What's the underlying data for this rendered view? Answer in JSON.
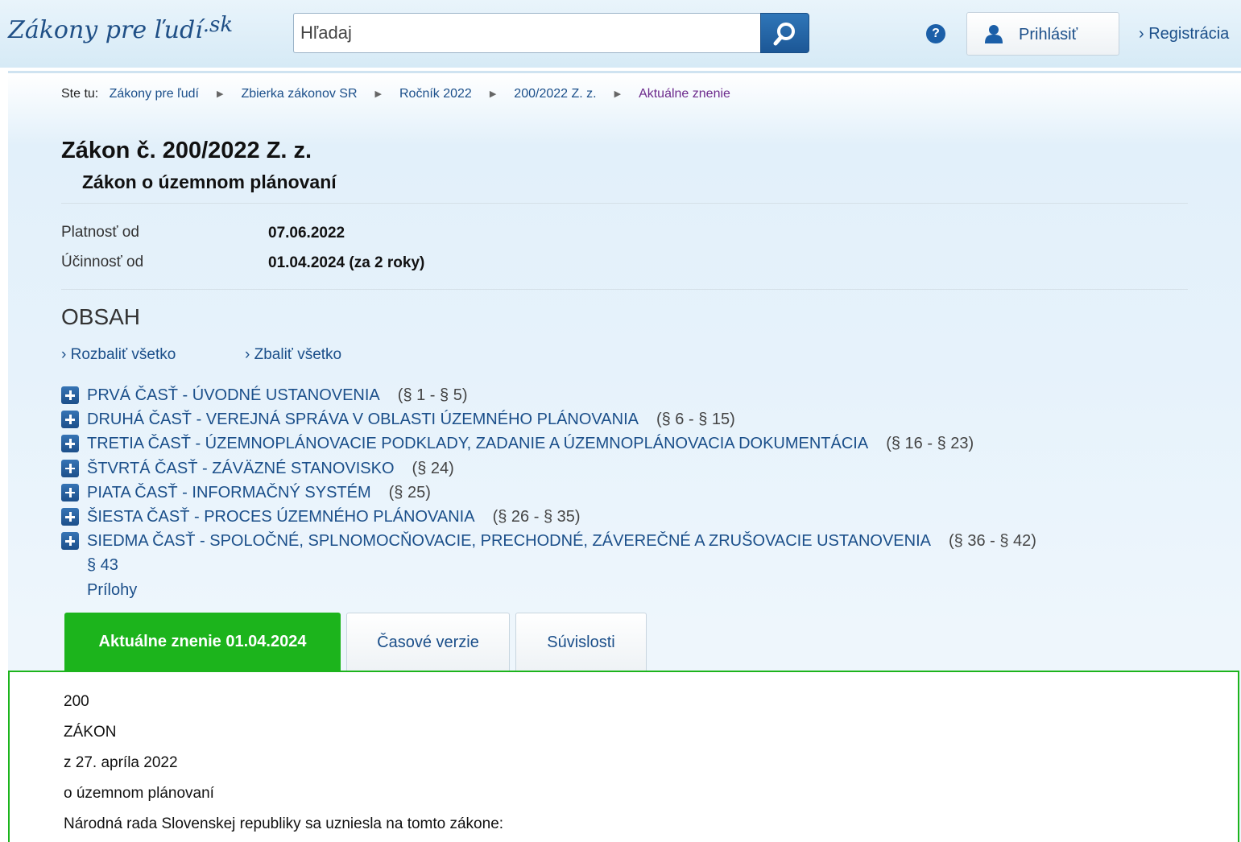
{
  "header": {
    "logo_text": "Zákony pre ľudí",
    "logo_tld": ".sk",
    "search_placeholder": "Hľadaj",
    "help_glyph": "?",
    "login_label": "Prihlásiť",
    "register_label": "› Registrácia",
    "icons": {
      "search": "search-icon",
      "help": "help-icon",
      "user": "user-icon"
    },
    "colors": {
      "accent": "#1b5fa8",
      "header_bg": "#dcedf8"
    }
  },
  "breadcrumb": {
    "prefix": "Ste tu:",
    "items": [
      "Zákony pre ľudí",
      "Zbierka zákonov SR",
      "Ročník 2022",
      "200/2022 Z. z."
    ],
    "current": "Aktuálne znenie"
  },
  "law": {
    "title": "Zákon č. 200/2022 Z. z.",
    "subtitle": "Zákon o územnom plánovaní",
    "meta": [
      {
        "label": "Platnosť od",
        "value": "07.06.2022"
      },
      {
        "label": "Účinnosť od",
        "value": "01.04.2024 (za 2 roky)"
      }
    ]
  },
  "toc": {
    "title": "OBSAH",
    "expand_all": "› Rozbaliť všetko",
    "collapse_all": "› Zbaliť všetko",
    "items": [
      {
        "label": "PRVÁ ČASŤ - ÚVODNÉ USTANOVENIA",
        "range": "(§ 1 - § 5)"
      },
      {
        "label": "DRUHÁ ČASŤ - VEREJNÁ SPRÁVA V OBLASTI ÚZEMNÉHO PLÁNOVANIA",
        "range": "(§ 6 - § 15)"
      },
      {
        "label": "TRETIA ČASŤ - ÚZEMNOPLÁNOVACIE PODKLADY, ZADANIE A ÚZEMNOPLÁNOVACIA DOKUMENTÁCIA",
        "range": "(§ 16 - § 23)"
      },
      {
        "label": "ŠTVRTÁ ČASŤ - ZÁVÄZNÉ STANOVISKO",
        "range": "(§ 24)"
      },
      {
        "label": "PIATA ČASŤ - INFORMAČNÝ SYSTÉM",
        "range": "(§ 25)"
      },
      {
        "label": "ŠIESTA ČASŤ - PROCES ÚZEMNÉHO PLÁNOVANIA",
        "range": "(§ 26 - § 35)"
      },
      {
        "label": "SIEDMA ČASŤ - SPOLOČNÉ, SPLNOMOCŇOVACIE, PRECHODNÉ, ZÁVEREČNÉ A ZRUŠOVACIE USTANOVENIA",
        "range": "(§ 36 - § 42)"
      }
    ],
    "extra": [
      "§ 43",
      "Prílohy"
    ]
  },
  "tabs": [
    {
      "label": "Aktuálne znenie 01.04.2024",
      "active": true
    },
    {
      "label": "Časové verzie",
      "active": false
    },
    {
      "label": "Súvislosti",
      "active": false
    }
  ],
  "tab_active_color": "#1cb41c",
  "content": {
    "lines": [
      "200",
      "ZÁKON",
      "z 27. apríla 2022",
      "o územnom plánovaní",
      "Národná rada Slovenskej republiky sa uzniesla na tomto zákone:"
    ]
  }
}
